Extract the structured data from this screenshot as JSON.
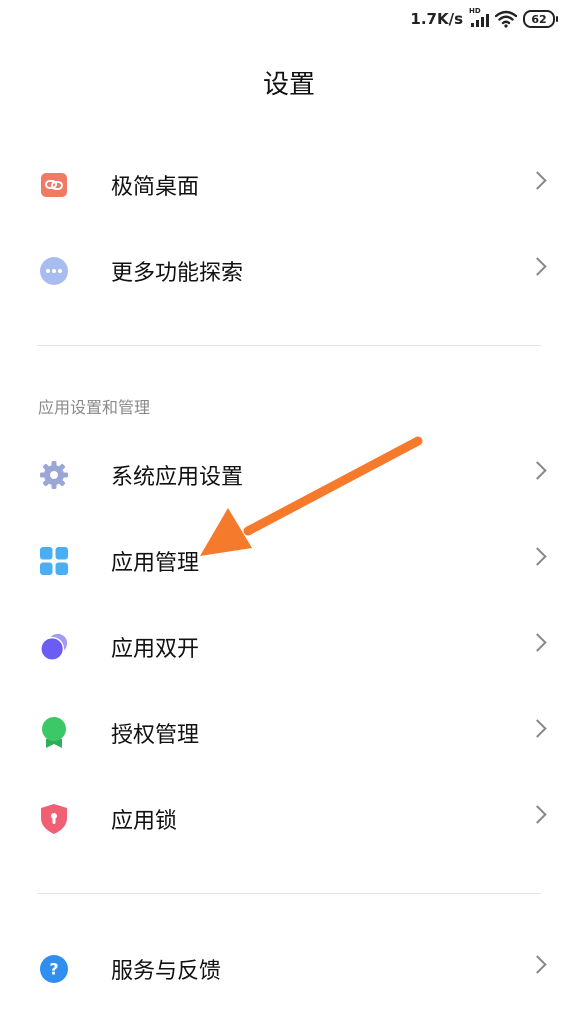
{
  "status_bar": {
    "net_speed": "1.7K/s",
    "signal_badge": "HD",
    "battery": "62"
  },
  "page": {
    "title": "设置"
  },
  "group1": {
    "items": [
      {
        "label": "极简桌面",
        "icon": "link-icon",
        "color": "#f07a64"
      },
      {
        "label": "更多功能探索",
        "icon": "more-dots-icon",
        "color": "#a8bcf0"
      }
    ]
  },
  "group2": {
    "header": "应用设置和管理",
    "items": [
      {
        "label": "系统应用设置",
        "icon": "gear-icon",
        "color": "#9aa6d6"
      },
      {
        "label": "应用管理",
        "icon": "grid-icon",
        "color": "#4aaef5"
      },
      {
        "label": "应用双开",
        "icon": "dual-circle-icon",
        "color": "#6a5cf5"
      },
      {
        "label": "授权管理",
        "icon": "badge-icon",
        "color": "#3cc866"
      },
      {
        "label": "应用锁",
        "icon": "shield-lock-icon",
        "color": "#f06075"
      }
    ]
  },
  "group3": {
    "items": [
      {
        "label": "服务与反馈",
        "icon": "help-icon",
        "color": "#2f8ef0"
      }
    ]
  },
  "annotation": {
    "arrow_color": "#f57a2c"
  }
}
